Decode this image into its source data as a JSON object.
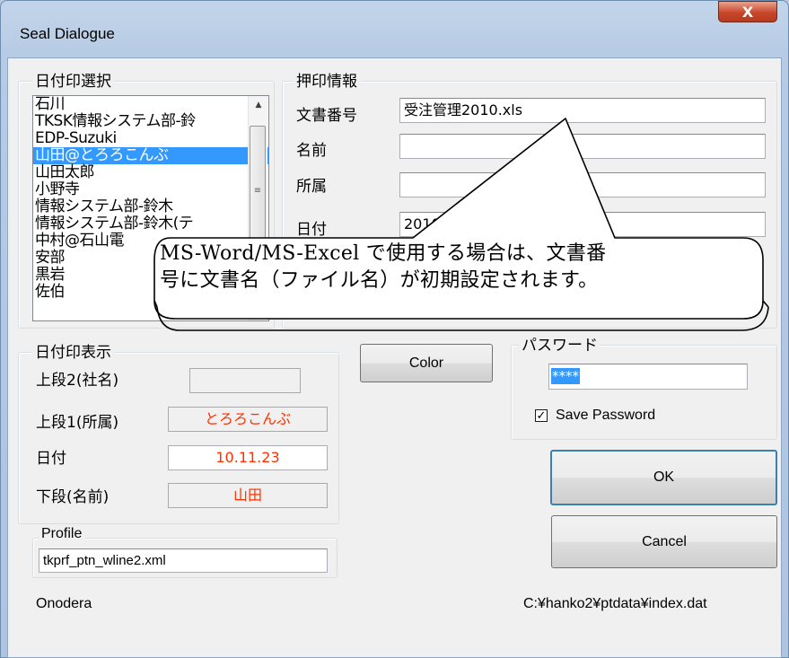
{
  "window": {
    "title": "Seal Dialogue",
    "close_glyph": "X"
  },
  "date_stamp_select": {
    "label": "日付印選択",
    "items": [
      "石川",
      "TKSK情報システム部-鈴",
      "EDP-Suzuki",
      "山田@とろろこんぶ",
      "山田太郎",
      "小野寺",
      "情報システム部-鈴木",
      "情報システム部-鈴木(テ",
      "中村@石山電",
      "安部",
      "黒岩",
      "佐伯"
    ],
    "selected_index": 3
  },
  "seal_info": {
    "label": "押印情報",
    "doc_number_label": "文書番号",
    "doc_number_value": "受注管理2010.xls",
    "name_label": "名前",
    "name_value": "",
    "affiliation_label": "所属",
    "affiliation_value": "",
    "date_label": "日付",
    "date_value": "2010年11月2"
  },
  "callout": {
    "line1": "MS-Word/MS-Excel で使用する場合は、文書番",
    "line2": "号に文書名（ファイル名）が初期設定されます。"
  },
  "date_stamp_display": {
    "label": "日付印表示",
    "upper2_label": "上段2(社名)",
    "upper2_value": "",
    "upper1_label": "上段1(所属)",
    "upper1_value": "とろろこんぶ",
    "date_label": "日付",
    "date_value": "10.11.23",
    "lower_label": "下段(名前)",
    "lower_value": "山田",
    "value_color": "#ff3000"
  },
  "color_button": "Color",
  "password": {
    "label": "パスワード",
    "value": "****",
    "save_label": "Save Password",
    "save_checked": true
  },
  "ok_button": "OK",
  "cancel_button": "Cancel",
  "profile": {
    "label": "Profile",
    "value": "tkprf_ptn_wline2.xml"
  },
  "status": {
    "user": "Onodera",
    "path": "C:¥hanko2¥ptdata¥index.dat"
  }
}
